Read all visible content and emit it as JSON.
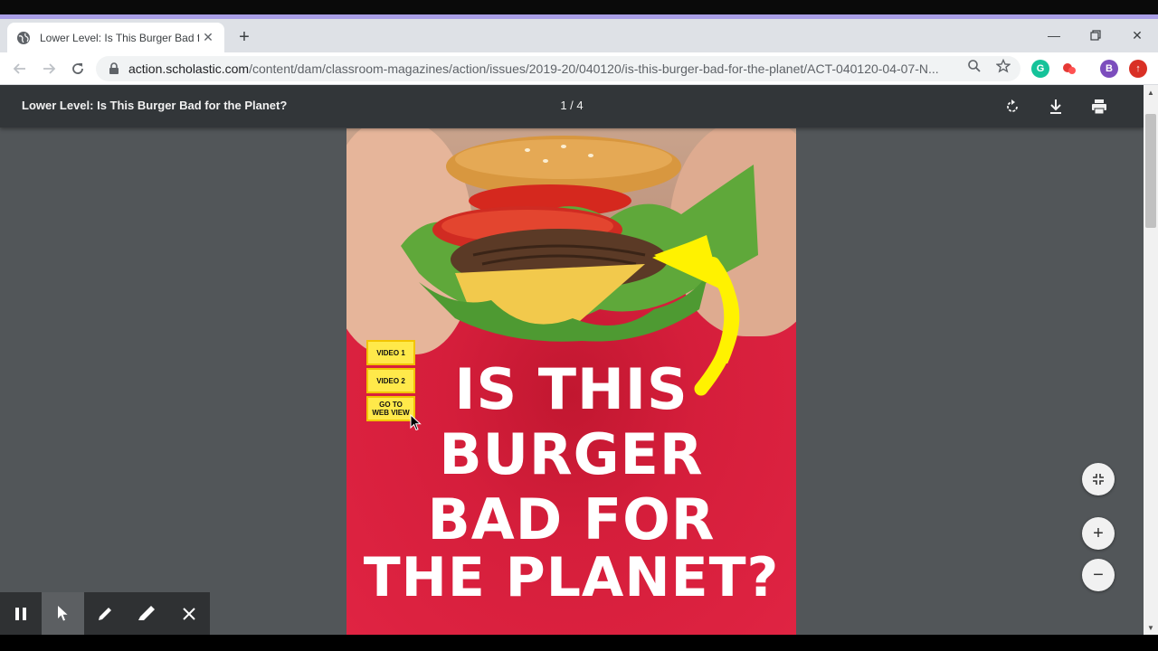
{
  "browser": {
    "tab_title": "Lower Level: Is This Burger Bad fo",
    "url_domain": "action.scholastic.com",
    "url_path": "/content/dam/classroom-magazines/action/issues/2019-20/040120/is-this-burger-bad-for-the-planet/ACT-040120-04-07-N...",
    "profile_initial": "B"
  },
  "pdf_viewer": {
    "title": "Lower Level: Is This Burger Bad for the Planet?",
    "page_indicator": "1 / 4"
  },
  "page": {
    "buttons": {
      "video1": "VIDEO 1",
      "video2": "VIDEO 2",
      "web_view_line1": "GO TO",
      "web_view_line2": "WEB VIEW"
    },
    "headline": {
      "line1": "IS THIS",
      "line2": "BURGER",
      "line3": "BAD FOR",
      "line4": "THE PLANET?"
    }
  },
  "colors": {
    "accent": "#a99ee6",
    "page_red": "#d21d3b",
    "button_yellow": "#ffe94a",
    "arrow_yellow": "#fff200"
  }
}
